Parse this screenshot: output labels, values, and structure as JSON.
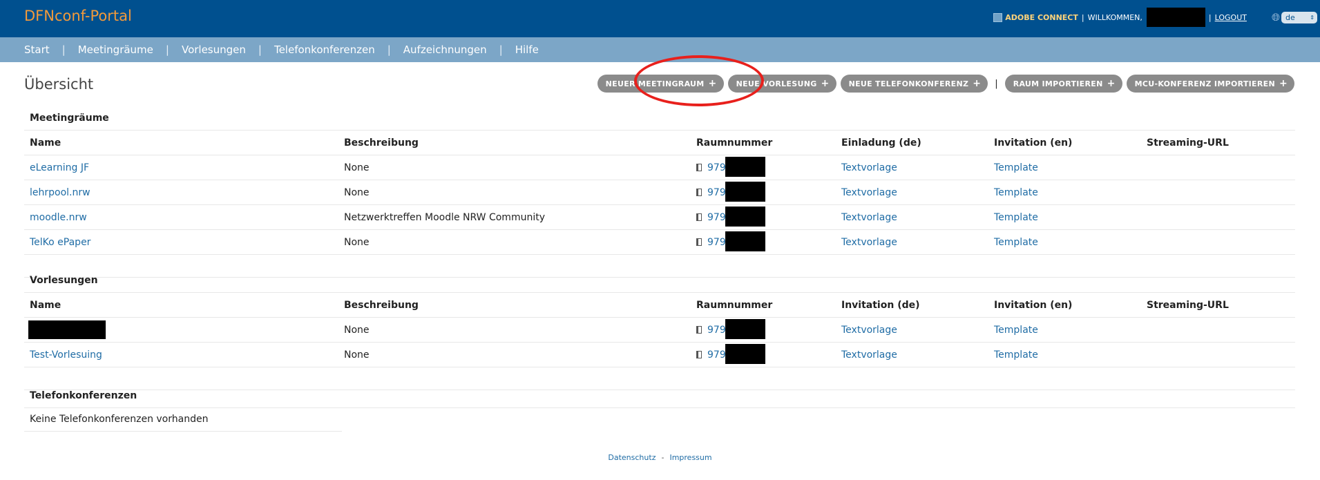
{
  "header": {
    "brand": "DFNconf-Portal",
    "adobe_connect_label": "ADOBE CONNECT",
    "separator": "|",
    "welcome_label": "WILLKOMMEN,",
    "logout_label": "LOGOUT",
    "language": "de",
    "globe_icon": "globe-icon"
  },
  "nav": {
    "items": [
      {
        "label": "Start"
      },
      {
        "label": "Meetingräume"
      },
      {
        "label": "Vorlesungen"
      },
      {
        "label": "Telefonkonferenzen"
      },
      {
        "label": "Aufzeichnungen"
      },
      {
        "label": "Hilfe"
      }
    ],
    "separator": "|"
  },
  "page": {
    "title": "Übersicht",
    "actions": [
      {
        "label": "NEUER MEETINGRAUM",
        "icon": "+"
      },
      {
        "label": "NEUE VORLESUNG",
        "icon": "+"
      },
      {
        "label": "NEUE TELEFONKONFERENZ",
        "icon": "+"
      },
      {
        "label": "RAUM IMPORTIEREN",
        "icon": "+"
      },
      {
        "label": "MCU-KONFERENZ IMPORTIEREN",
        "icon": "+"
      }
    ],
    "action_separator": "|"
  },
  "meetingrooms": {
    "title": "Meetingräume",
    "columns": [
      "Name",
      "Beschreibung",
      "Raumnummer",
      "Einladung (de)",
      "Invitation (en)",
      "Streaming-URL"
    ],
    "rows": [
      {
        "name": "eLearning JF",
        "description": "None",
        "room": "9796",
        "inv_de": "Textvorlage",
        "inv_en": "Template",
        "stream": ""
      },
      {
        "name": "lehrpool.nrw",
        "description": "None",
        "room": "9796",
        "inv_de": "Textvorlage",
        "inv_en": "Template",
        "stream": ""
      },
      {
        "name": "moodle.nrw",
        "description": "Netzwerktreffen Moodle NRW Community",
        "room": "9797",
        "inv_de": "Textvorlage",
        "inv_en": "Template",
        "stream": ""
      },
      {
        "name": "TelKo ePaper",
        "description": "None",
        "room": "9796",
        "inv_de": "Textvorlage",
        "inv_en": "Template",
        "stream": ""
      }
    ]
  },
  "lectures": {
    "title": "Vorlesungen",
    "columns": [
      "Name",
      "Beschreibung",
      "Raumnummer",
      "Invitation (de)",
      "Invitation (en)",
      "Streaming-URL"
    ],
    "rows": [
      {
        "name": "",
        "description": "None",
        "room": "9798",
        "inv_de": "Textvorlage",
        "inv_en": "Template",
        "stream": ""
      },
      {
        "name": "Test-Vorlesuing",
        "description": "None",
        "room": "9798",
        "inv_de": "Textvorlage",
        "inv_en": "Template",
        "stream": ""
      }
    ]
  },
  "phoneconf": {
    "title": "Telefonkonferenzen",
    "empty_text": "Keine Telefonkonferenzen vorhanden"
  },
  "footer": {
    "privacy": "Datenschutz",
    "separator": "-",
    "imprint": "Impressum"
  },
  "colors": {
    "header_bg": "#00508f",
    "nav_bg": "#7ca6c7",
    "brand": "#f39a3a",
    "link": "#1f6ca5",
    "button_bg": "#8b8b8b",
    "highlight_circle": "#e8201c"
  }
}
